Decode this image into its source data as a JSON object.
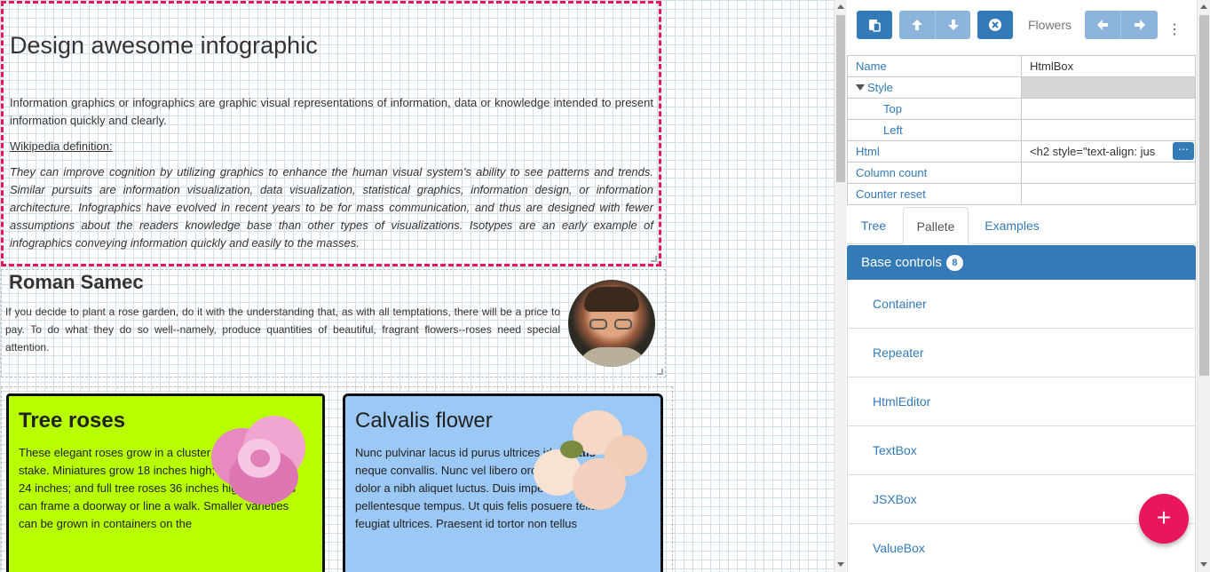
{
  "infographic": {
    "title": "Design awesome infographic",
    "intro": "Information graphics or infographics are graphic visual representations of information, data or knowledge intended to present information quickly and clearly.",
    "wiki_label": "Wikipedia definition:",
    "quote": "They can improve cognition by utilizing graphics to enhance the human visual system’s ability to see patterns and trends. Similar pursuits are information visualization, data visualization, statistical graphics, information design, or information architecture. Infographics have evolved in recent years to be for mass communication, and thus are designed with fewer assumptions about the readers knowledge base than other types of visualizations. Isotypes are an early example of infographics conveying information quickly and easily to the masses."
  },
  "author": {
    "name": "Roman Samec",
    "text": "If you decide to plant a rose garden, do it with the understanding that, as with all temptations, there will be a price to pay. To do what they do so well--namely, produce quantities of beautiful, fragrant flowers--roses need special attention."
  },
  "cards": [
    {
      "title": "Tree roses",
      "text": "These elegant roses grow in a cluster at the top of a stake. Miniatures grow 18 inches high; patio varieties 24 inches; and full tree roses 36 inches high. Tall ones can frame a doorway or line a walk. Smaller varieties can be grown in containers on the",
      "color": "#b8ff00"
    },
    {
      "title": "Calvalis flower",
      "text_before": "Nunc pulvinar lacus id purus ultrices id ",
      "text_bold": "sagittis",
      "text_after": " neque convallis. Nunc vel libero orci. Vivamus at dolor a nibh aliquet luctus. Duis imperdiet mi id lorem pellentesque tempus. Ut quis felis posuere tellus feugiat ultrices. Praesent id tortor non tellus",
      "color": "#9cc8f5"
    }
  ],
  "toolbar": {
    "paste_icon": "paste-icon",
    "up_icon": "arrow-up-icon",
    "down_icon": "arrow-down-icon",
    "close_icon": "close-circle-icon",
    "selected_label": "Flowers",
    "left_icon": "arrow-left-icon",
    "right_icon": "arrow-right-icon",
    "more_icon": "more-vertical-icon"
  },
  "properties": [
    {
      "name": "Name",
      "value": "HtmlBox"
    },
    {
      "name": "Style",
      "value": ""
    },
    {
      "name": "Top",
      "value": ""
    },
    {
      "name": "Left",
      "value": ""
    },
    {
      "name": "Html",
      "value": "<h2 style=\"text-align: jus"
    },
    {
      "name": "Column count",
      "value": ""
    },
    {
      "name": "Counter reset",
      "value": ""
    }
  ],
  "tabs": [
    "Tree",
    "Pallete",
    "Examples"
  ],
  "active_tab": "Pallete",
  "pallete": {
    "header": "Base controls",
    "count": "8",
    "items": [
      "Container",
      "Repeater",
      "HtmlEditor",
      "TextBox",
      "JSXBox",
      "ValueBox"
    ]
  },
  "fab_label": "+",
  "colors": {
    "accent": "#337ab7",
    "selection": "#e8175d",
    "fab": "#e8175d"
  }
}
